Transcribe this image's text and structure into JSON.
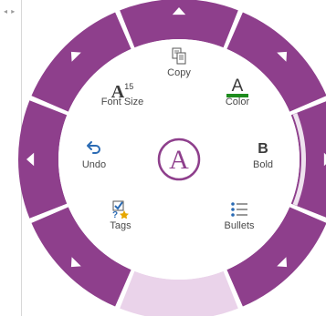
{
  "colors": {
    "ring": "#8e3f8c",
    "ring_inactive": "#ead3ea",
    "center_accent": "#8e3f8c",
    "color_underline": "#1e8c1e",
    "undo_arrow": "#2b6bb4",
    "tags_check": "#2b6bb4",
    "tags_star": "#e6a700"
  },
  "commands": {
    "copy": {
      "label": "Copy",
      "icon": "copy-icon"
    },
    "font_size": {
      "label": "Font Size",
      "glyph": "A",
      "superscript": "15",
      "icon": "font-size-icon"
    },
    "color": {
      "label": "Color",
      "glyph": "A",
      "icon": "font-color-icon"
    },
    "undo": {
      "label": "Undo",
      "glyph": "↶",
      "icon": "undo-icon"
    },
    "bold": {
      "label": "Bold",
      "glyph": "B",
      "icon": "bold-icon"
    },
    "tags": {
      "label": "Tags",
      "icon": "tags-icon"
    },
    "bullets": {
      "label": "Bullets",
      "icon": "bullets-icon"
    }
  },
  "center": {
    "glyph": "A",
    "icon": "radial-menu-center-icon"
  },
  "left_strip": {
    "arrows": "◂ ▸"
  }
}
